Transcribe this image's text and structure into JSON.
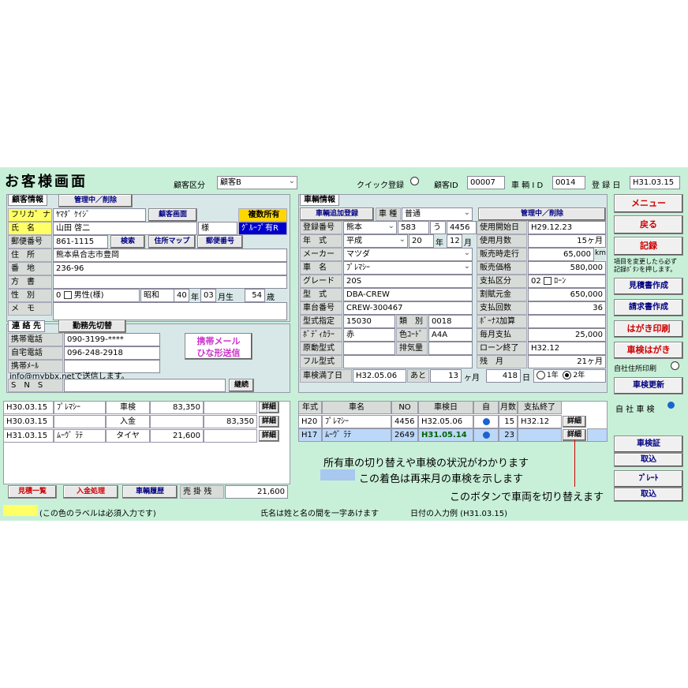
{
  "header": {
    "title": "お客様画面",
    "customer_type_label": "顧客区分",
    "customer_type_value": "顧客B",
    "quick_label": "クイック登録",
    "customer_id_label": "顧客ID",
    "customer_id_value": "00007",
    "vehicle_id_label": "車 輌 I D",
    "vehicle_id_value": "0014",
    "reg_date_label": "登 録 日",
    "reg_date_value": "H31.03.15"
  },
  "customer": {
    "title": "顧客情報",
    "manage_btn": "管理中／削除",
    "furigana_label": "フリカ゛ナ",
    "furigana_value": "ﾔﾏﾀﾞ ｹｲｼﾞ",
    "customer_screen_btn": "顧客画面",
    "multi_owner_label": "複数所有",
    "name_label": "氏　名",
    "name_value": "山田 啓二",
    "sama": "様",
    "group_label": "ｸﾞﾙｰﾌﾟ有R",
    "zip_label": "郵便番号",
    "zip_value": "861-1115",
    "search_btn": "検索",
    "address_map_btn": "住所マップ",
    "zip_btn": "郵便番号",
    "address_label": "住　所",
    "address_value": "熊本県合志市豊岡",
    "banchi_label": "番　地",
    "banchi_value": "236-96",
    "katagaki_label": "方　書",
    "gender_label": "性　別",
    "gender_code": "0",
    "gender_value": "男性(様)",
    "era_value": "昭和",
    "year_value": "40",
    "year_label": "年",
    "month_value": "03",
    "month_label": "月生",
    "age_value": "54",
    "age_label": "歳",
    "memo_label": "メ　モ"
  },
  "contact": {
    "title": "連 絡 先",
    "switch_btn": "勤務先切替",
    "mobile_label": "携帯電話",
    "mobile_value": "090-3199-****",
    "home_label": "自宅電話",
    "home_value": "096-248-2918",
    "mail_label": "携帯ﾒｰﾙ",
    "mail_btn_line1": "携帯メール",
    "mail_btn_line2": "ひな形送信",
    "mail_note": "info@mybbx.netで送信します。",
    "sns_label": "S　N　S",
    "continue_btn": "継続"
  },
  "vehicle": {
    "title": "車輌情報",
    "add_btn": "車輌追加登録",
    "kind_label": "車 種",
    "kind_value": "普通",
    "manage_btn": "管理中／削除",
    "reg_label": "登録番号",
    "reg_area": "熊本",
    "reg_class": "583",
    "reg_kana": "う",
    "reg_num": "4456",
    "start_label": "使用開始日",
    "start_value": "H29.12.23",
    "year_label": "年　式",
    "year_era": "平成",
    "year_value": "20",
    "year_unit": "年",
    "month_value": "12",
    "month_unit": "月",
    "use_months_label": "使用月数",
    "use_months_value": "15ヶ月",
    "maker_label": "メーカー",
    "maker_value": "マツダ",
    "sale_km_label": "販売時走行",
    "sale_km_value": "65,000",
    "km_unit": "km",
    "model_name_label": "車　名",
    "model_name_value": "ﾌﾟﾚﾏｼｰ",
    "price_label": "販売価格",
    "price_value": "580,000",
    "grade_label": "グレード",
    "grade_value": "20S",
    "pay_label": "支払区分",
    "pay_code": "02",
    "pay_value": "ﾛｰﾝ",
    "type_label": "型　式",
    "type_value": "DBA-CREW",
    "principal_label": "割賦元金",
    "principal_value": "650,000",
    "chassis_label": "車台番号",
    "chassis_value": "CREW-300467",
    "pay_count_label": "支払回数",
    "pay_count_value": "36",
    "spec_label": "型式指定",
    "spec_value": "15030",
    "category_label": "類　別",
    "category_value": "0018",
    "bonus_label": "ﾎﾞｰﾅｽ加算",
    "color_label": "ﾎﾞﾃﾞｨｶﾗｰ",
    "color_value": "赤",
    "color_code_label": "色ｺｰﾄﾞ",
    "color_code_value": "A4A",
    "monthly_label": "毎月支払",
    "monthly_value": "25,000",
    "motor_label": "原動型式",
    "displacement_label": "排気量",
    "loan_end_label": "ローン終了",
    "loan_end_value": "H32.12",
    "full_type_label": "フル型式",
    "remain_label": "残　月",
    "remain_value": "21ヶ月",
    "inspect_label": "車検満了日",
    "inspect_value": "H32.05.06",
    "ato_label": "あと",
    "ato_months": "13",
    "months_unit": "ヶ月",
    "ato_days": "418",
    "days_unit": "日",
    "opt_1year": "1年",
    "opt_2year": "2年"
  },
  "history": {
    "rows": [
      {
        "date": "H30.03.15",
        "car": "ﾌﾟﾚﾏｼｰ",
        "item": "車検",
        "amount": "83,350",
        "paid": "",
        "btn": "詳細"
      },
      {
        "date": "H30.03.15",
        "car": "",
        "item": "入金",
        "amount": "",
        "paid": "83,350",
        "btn": "詳細"
      },
      {
        "date": "H31.03.15",
        "car": "ﾑｰｳﾞ ﾗﾃ",
        "item": "タイヤ",
        "amount": "21,600",
        "paid": "",
        "btn": "詳細"
      }
    ],
    "estimate_btn": "見積一覧",
    "payment_btn": "入金処理",
    "car_history_btn": "車輌履歴",
    "balance_label": "売 掛 残",
    "balance_value": "21,600"
  },
  "cars": {
    "headers": [
      "年式",
      "車名",
      "NO",
      "車検日",
      "自",
      "月数",
      "支払終了"
    ],
    "rows": [
      {
        "year": "H20",
        "name": "ﾌﾟﾚﾏｼｰ",
        "no": "4456",
        "date": "H32.05.06",
        "months": "15",
        "end": "H32.12",
        "btn": "詳細"
      },
      {
        "year": "H17",
        "name": "ﾑｰｳﾞ ﾗﾃ",
        "no": "2649",
        "date": "H31.05.14",
        "months": "23",
        "end": "",
        "btn": "詳細"
      }
    ]
  },
  "annotations": {
    "line1": "所有車の切り替えや車検の状況がわかります",
    "line2": "この着色は再来月の車検を示します",
    "line3": "このボタンで車両を切り替えます"
  },
  "right": {
    "menu_btn": "メニュー",
    "back_btn": "戻る",
    "record_btn": "記録",
    "record_note_line1": "項目を変更したら必ず",
    "record_note_line2": "記録ﾎﾞﾀﾝを押します。",
    "estimate_btn": "見積書作成",
    "invoice_btn": "請求書作成",
    "postcard_btn": "はがき印刷",
    "inspect_postcard_btn": "車検はがき",
    "print_own_label": "自社住所印刷",
    "inspect_update_btn": "車検更新",
    "own_car_label": "自 社 車 検",
    "shaken_btn": "車検証",
    "import1_btn": "取込",
    "plate_btn": "ﾌﾟﾚｰﾄ",
    "import2_btn": "取込"
  },
  "footer": {
    "required_note": "(この色のラベルは必須入力です)",
    "name_note": "氏名は姓と名の間を一字あけます",
    "date_note": "日付の入力例 (H31.03.15)"
  },
  "colors": {
    "background": "#c8f0d8",
    "required": "#ffff66",
    "highlight": "#bcd8f8",
    "accent_red": "#cc0000",
    "navy": "#000080"
  }
}
